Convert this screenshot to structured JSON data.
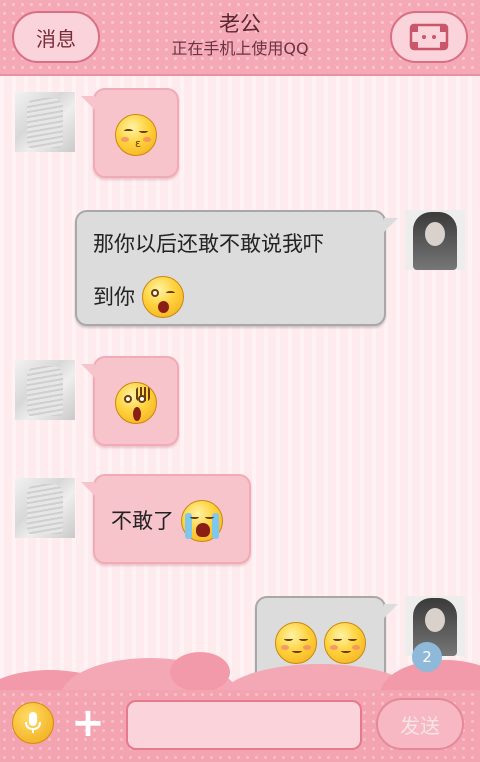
{
  "header": {
    "back_label": "消息",
    "title": "老公",
    "subtitle": "正在手机上使用QQ",
    "menu_icon": "profile-card-icon"
  },
  "messages": [
    {
      "side": "left",
      "emoji": "kiss-emoji"
    },
    {
      "side": "right",
      "text_line1": "那你以后还敢不敢说我吓",
      "text_line2": "到你",
      "emoji": "surprised-emoji"
    },
    {
      "side": "left",
      "emoji": "shocked-emoji"
    },
    {
      "side": "left",
      "text": "不敢了",
      "emoji": "crying-emoji"
    },
    {
      "side": "right",
      "emojis": [
        "content-emoji",
        "content-emoji"
      ]
    }
  ],
  "composer": {
    "voice_icon": "microphone-icon",
    "plus_icon": "plus-icon",
    "input_value": "",
    "send_label": "发送",
    "unread_count": "2"
  },
  "colors": {
    "header_pink": "#f5a9b7",
    "left_bubble": "#f8c4cc",
    "right_bubble": "#dcdcdc",
    "badge_blue": "#8fb9d8"
  }
}
